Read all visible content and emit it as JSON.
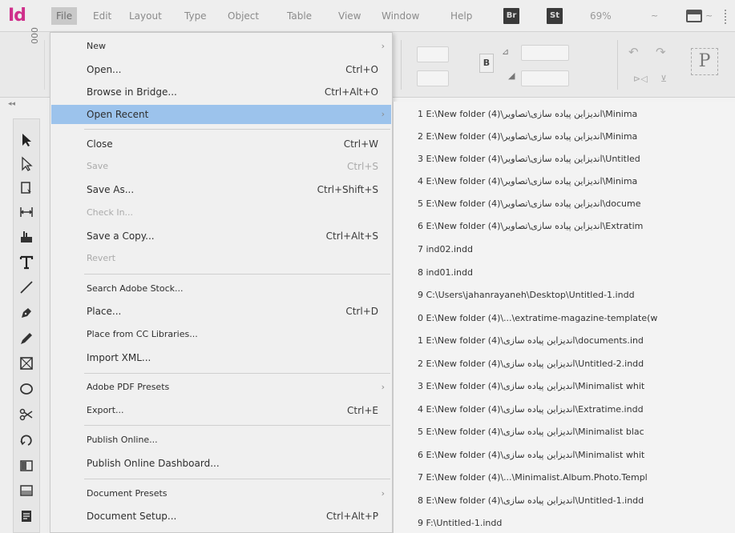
{
  "app": {
    "logo": "Id"
  },
  "menubar": {
    "items": [
      "File",
      "Edit",
      "Layout",
      "Type",
      "Object",
      "Table",
      "View",
      "Window",
      "Help"
    ],
    "badge_br": "Br",
    "badge_st": "St",
    "zoom": "69%",
    "zoom_arrow": "~",
    "screen_arrow": "~"
  },
  "controlpanel": {
    "ref_glyph": "000",
    "b_label": "B",
    "p_label": "P"
  },
  "file_menu": {
    "items": [
      {
        "label": "New",
        "shortcut": "",
        "arrow": "›",
        "disabled": false
      },
      {
        "label": "Open...",
        "shortcut": "Ctrl+O",
        "arrow": "",
        "disabled": false
      },
      {
        "label": "Browse in Bridge...",
        "shortcut": "Ctrl+Alt+O",
        "arrow": "",
        "disabled": false
      },
      {
        "label": "Open Recent",
        "shortcut": "",
        "arrow": "›",
        "disabled": false
      },
      {
        "label": "Close",
        "shortcut": "Ctrl+W",
        "arrow": "",
        "disabled": false
      },
      {
        "label": "Save",
        "shortcut": "Ctrl+S",
        "arrow": "",
        "disabled": true
      },
      {
        "label": "Save As...",
        "shortcut": "Ctrl+Shift+S",
        "arrow": "",
        "disabled": false
      },
      {
        "label": "Check In...",
        "shortcut": "",
        "arrow": "",
        "disabled": true
      },
      {
        "label": "Save a Copy...",
        "shortcut": "Ctrl+Alt+S",
        "arrow": "",
        "disabled": false
      },
      {
        "label": "Revert",
        "shortcut": "",
        "arrow": "",
        "disabled": true
      },
      {
        "label": "Search Adobe Stock...",
        "shortcut": "",
        "arrow": "",
        "disabled": false
      },
      {
        "label": "Place...",
        "shortcut": "Ctrl+D",
        "arrow": "",
        "disabled": false
      },
      {
        "label": "Place from CC Libraries...",
        "shortcut": "",
        "arrow": "",
        "disabled": false
      },
      {
        "label": "Import XML...",
        "shortcut": "",
        "arrow": "",
        "disabled": false
      },
      {
        "label": "Adobe PDF Presets",
        "shortcut": "",
        "arrow": "›",
        "disabled": false
      },
      {
        "label": "Export...",
        "shortcut": "Ctrl+E",
        "arrow": "",
        "disabled": false
      },
      {
        "label": "Publish Online...",
        "shortcut": "",
        "arrow": "",
        "disabled": false
      },
      {
        "label": "Publish Online Dashboard...",
        "shortcut": "",
        "arrow": "",
        "disabled": false
      },
      {
        "label": "Document Presets",
        "shortcut": "",
        "arrow": "›",
        "disabled": false
      },
      {
        "label": "Document Setup...",
        "shortcut": "Ctrl+Alt+P",
        "arrow": "",
        "disabled": false
      }
    ]
  },
  "open_recent": {
    "items": [
      "1 E:\\New folder (4)\\اندیزاین پیاده سازی\\تصاویر\\Minima",
      "2 E:\\New folder (4)\\اندیزاین پیاده سازی\\تصاویر\\Minima",
      "3 E:\\New folder (4)\\اندیزاین پیاده سازی\\تصاویر\\Untitled",
      "4 E:\\New folder (4)\\اندیزاین پیاده سازی\\تصاویر\\Minima",
      "5 E:\\New folder (4)\\اندیزاین پیاده سازی\\تصاویر\\docume",
      "6 E:\\New folder (4)\\اندیزاین پیاده سازی\\تصاویر\\Extratim",
      "7 ind02.indd",
      "8 ind01.indd",
      "9 C:\\Users\\jahanrayaneh\\Desktop\\Untitled-1.indd",
      "0 E:\\New folder (4)\\...\\extratime-magazine-template(w",
      "1 E:\\New folder (4)\\اندیزاین پیاده سازی\\documents.ind",
      "2 E:\\New folder (4)\\اندیزاین پیاده سازی\\Untitled-2.indd",
      "3 E:\\New folder (4)\\اندیزاین پیاده سازی\\Minimalist whit",
      "4 E:\\New folder (4)\\اندیزاین پیاده سازی\\Extratime.indd",
      "5 E:\\New folder (4)\\اندیزاین پیاده سازی\\Minimalist blac",
      "6 E:\\New folder (4)\\اندیزاین پیاده سازی\\Minimalist whit",
      "7 E:\\New folder (4)\\...\\Minimalist.Album.Photo.Templ",
      "8 E:\\New folder (4)\\اندیزاین پیاده سازی\\Untitled-1.indd",
      "9 F:\\Untitled-1.indd"
    ]
  },
  "colors": {
    "accent_highlight": "#9cc3ec",
    "logo": "#cf2f8b",
    "menu_bg": "#f0f0f0"
  }
}
